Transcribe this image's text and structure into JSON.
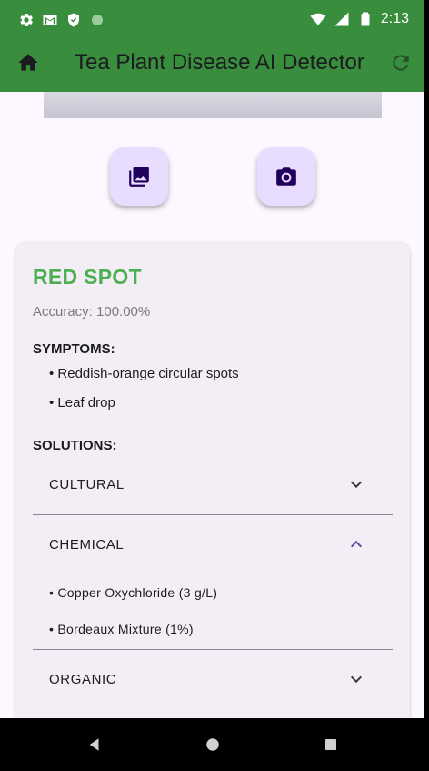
{
  "status_bar": {
    "time": "2:13",
    "icons": [
      "gear-icon",
      "gmail-icon",
      "shield-icon",
      "circle-icon"
    ],
    "right_icons": [
      "wifi-icon",
      "signal-icon",
      "battery-icon"
    ]
  },
  "app_bar": {
    "title": "Tea Plant Disease AI  Detector",
    "home_icon": "home-icon",
    "refresh_icon": "refresh-icon",
    "color": "#388e3c"
  },
  "actions": {
    "gallery_icon": "photo-library-icon",
    "camera_icon": "camera-icon"
  },
  "result": {
    "disease_name": "RED SPOT",
    "accuracy_text": "Accuracy: 100.00%",
    "symptoms_title": "SYMPTOMS:",
    "symptoms": [
      "• Reddish-orange circular spots",
      "• Leaf drop"
    ],
    "solutions_title": "SOLUTIONS:",
    "solutions": [
      {
        "label": "CULTURAL",
        "expanded": false,
        "items": []
      },
      {
        "label": "CHEMICAL",
        "expanded": true,
        "items": [
          "• Copper Oxychloride (3 g/L)",
          "• Bordeaux Mixture (1%)"
        ]
      },
      {
        "label": "ORGANIC",
        "expanded": false,
        "items": []
      }
    ],
    "name_color": "#4caf50",
    "expanded_chevron_color": "#5b4ea0"
  }
}
